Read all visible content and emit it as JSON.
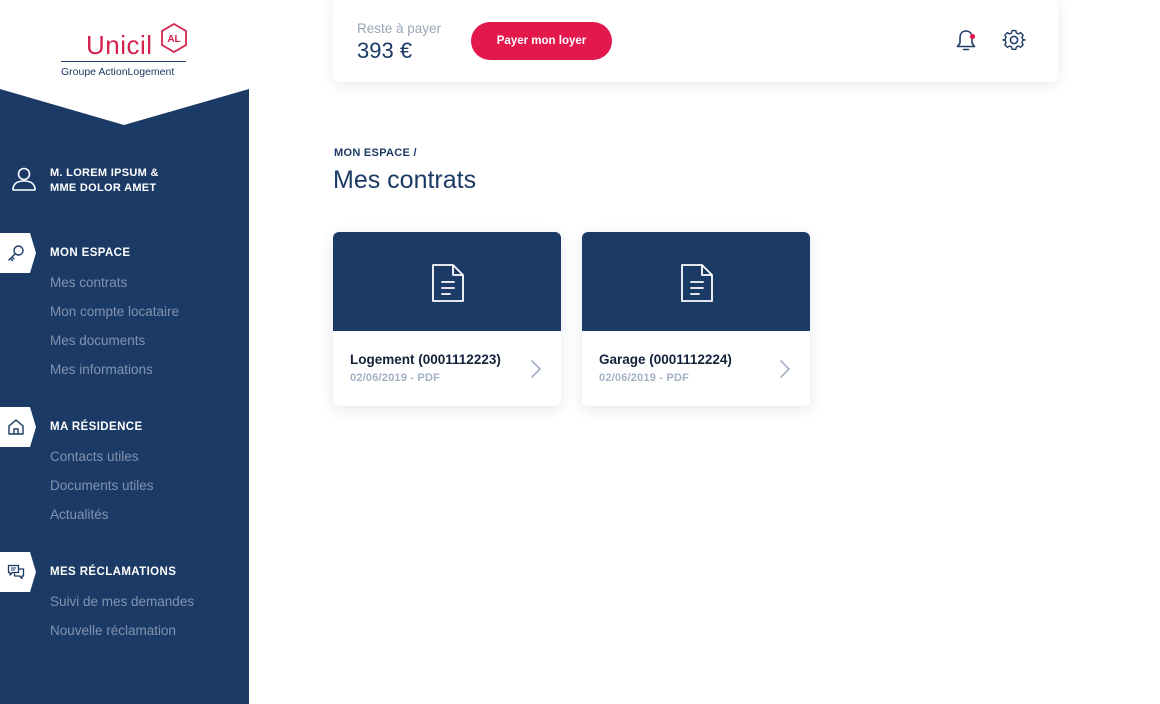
{
  "brand": {
    "name": "Unicil",
    "mark": "AL",
    "subtitle": "Groupe ActionLogement",
    "colors": {
      "navy": "#1c3a66",
      "red": "#e3184d"
    }
  },
  "user": {
    "icon": "user-icon",
    "line1": "M. LOREM IPSUM &",
    "line2": "MME DOLOR AMET"
  },
  "sidebar": {
    "sections": [
      {
        "icon": "key-icon",
        "title": "MON ESPACE",
        "items": [
          "Mes contrats",
          "Mon compte locataire",
          "Mes documents",
          "Mes informations"
        ]
      },
      {
        "icon": "home-icon",
        "title": "MA RÉSIDENCE",
        "items": [
          "Contacts utiles",
          "Documents utiles",
          "Actualités"
        ]
      },
      {
        "icon": "chat-icon",
        "title": "MES RÉCLAMATIONS",
        "items": [
          "Suivi de mes demandes",
          "Nouvelle réclamation"
        ]
      }
    ]
  },
  "header": {
    "balance_label": "Reste à payer",
    "balance_amount": "393 €",
    "pay_button": "Payer mon loyer",
    "icons": [
      "bell-icon",
      "gear-icon"
    ]
  },
  "main": {
    "breadcrumb": "MON ESPACE /",
    "title": "Mes contrats",
    "contracts": [
      {
        "icon": "document-icon",
        "title": "Logement (0001112223)",
        "meta": "02/06/2019 - PDF"
      },
      {
        "icon": "document-icon",
        "title": "Garage (0001112224)",
        "meta": "02/06/2019 - PDF"
      }
    ]
  }
}
